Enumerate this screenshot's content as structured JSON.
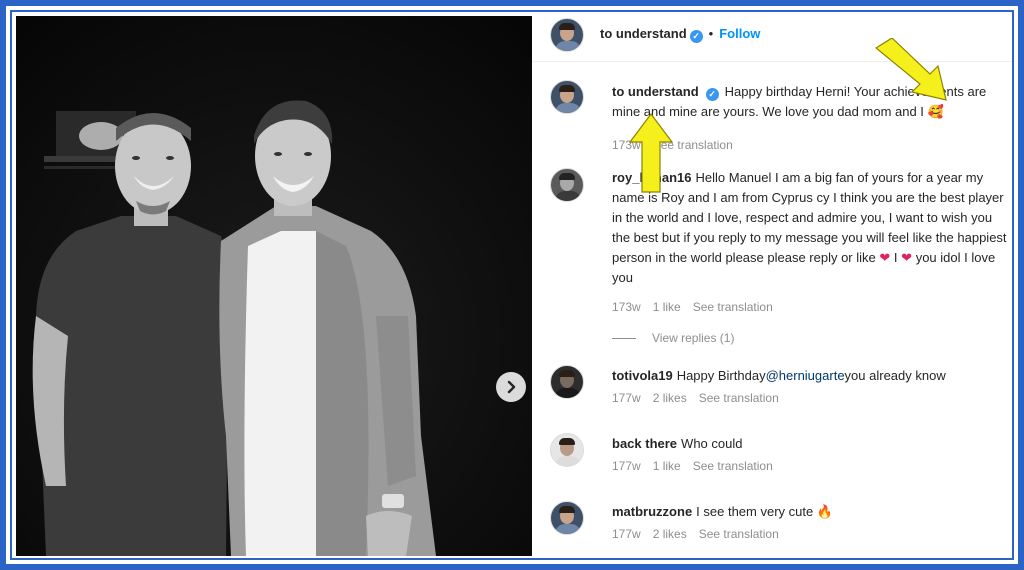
{
  "post": {
    "username": "to understand",
    "follow_label": "Follow",
    "dot": "•"
  },
  "caption": {
    "username": "to understand",
    "text": "Happy birthday Herni! Your achievements are mine and mine are yours. We love you dad mom and I",
    "emoji": "🥰",
    "time": "173w",
    "translation": "See translation"
  },
  "comments": [
    {
      "username": "roy_lyman16",
      "text": "Hello Manuel I am a big fan of yours for a year my name is Roy and I am from Cyprus cy I think you are the best player in the world and I love, respect and admire you, I want to wish you the best but if you reply to my message you will feel like the happiest person in the world please please reply or like",
      "tail_mid": "I",
      "tail_end": "you idol I love you",
      "time": "173w",
      "likes": "1 like",
      "translation": "See translation",
      "view_replies": "View replies (1)"
    },
    {
      "username": "totivola19",
      "text_before": "Happy Birthday",
      "mention": "@herniugarte",
      "text_after": "you already know",
      "time": "177w",
      "likes": "2 likes",
      "translation": "See translation"
    },
    {
      "username": "back there",
      "text": "Who could",
      "time": "177w",
      "likes": "1 like",
      "translation": "See translation"
    },
    {
      "username": "matbruzzone",
      "text": "I see them very cute",
      "emoji": "🔥",
      "time": "177w",
      "likes": "2 likes",
      "translation": "See translation"
    }
  ],
  "icons": {
    "verified": "✓",
    "next": "›",
    "heart": "❤"
  },
  "colors": {
    "frame": "#2b63c6",
    "follow": "#0095f6",
    "verified": "#3897f0",
    "arrow": "#f5ef1c"
  }
}
